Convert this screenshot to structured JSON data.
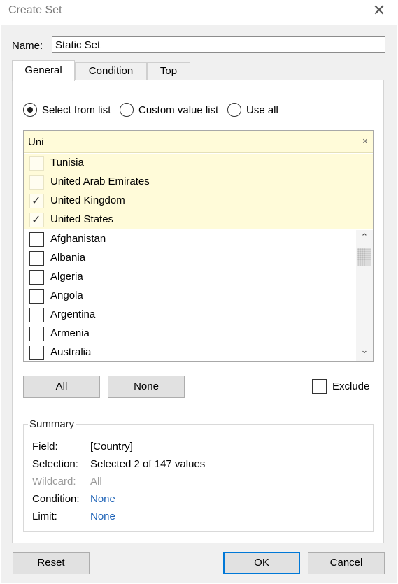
{
  "window": {
    "title": "Create Set",
    "close_glyph": "✕"
  },
  "name_field": {
    "label": "Name:",
    "value": "Static Set"
  },
  "tabs": [
    {
      "label": "General",
      "active": true
    },
    {
      "label": "Condition",
      "active": false
    },
    {
      "label": "Top",
      "active": false
    }
  ],
  "mode": {
    "options": [
      {
        "label": "Select from list",
        "checked": true
      },
      {
        "label": "Custom value list",
        "checked": false
      },
      {
        "label": "Use all",
        "checked": false
      }
    ]
  },
  "search": {
    "value": "Uni",
    "clear_glyph": "×"
  },
  "matches": [
    {
      "label": "Tunisia",
      "checked": false
    },
    {
      "label": "United Arab Emirates",
      "checked": false
    },
    {
      "label": "United Kingdom",
      "checked": true
    },
    {
      "label": "United States",
      "checked": true
    }
  ],
  "values": [
    {
      "label": "Afghanistan",
      "checked": false
    },
    {
      "label": "Albania",
      "checked": false
    },
    {
      "label": "Algeria",
      "checked": false
    },
    {
      "label": "Angola",
      "checked": false
    },
    {
      "label": "Argentina",
      "checked": false
    },
    {
      "label": "Armenia",
      "checked": false
    },
    {
      "label": "Australia",
      "checked": false
    }
  ],
  "scroll": {
    "up_glyph": "⌃",
    "down_glyph": "⌄"
  },
  "list_buttons": {
    "all_label": "All",
    "none_label": "None"
  },
  "exclude": {
    "label": "Exclude",
    "checked": false
  },
  "summary": {
    "legend": "Summary",
    "rows": [
      {
        "key": "Field:",
        "value": "[Country]"
      },
      {
        "key": "Selection:",
        "value": "Selected 2 of 147 values"
      },
      {
        "key": "Wildcard:",
        "value": "All"
      },
      {
        "key": "Condition:",
        "value": "None"
      },
      {
        "key": "Limit:",
        "value": "None"
      }
    ]
  },
  "footer": {
    "reset_label": "Reset",
    "ok_label": "OK",
    "cancel_label": "Cancel"
  },
  "colors": {
    "highlight": "#fffbd9",
    "link": "#1f64b8",
    "accent": "#0078d7"
  }
}
